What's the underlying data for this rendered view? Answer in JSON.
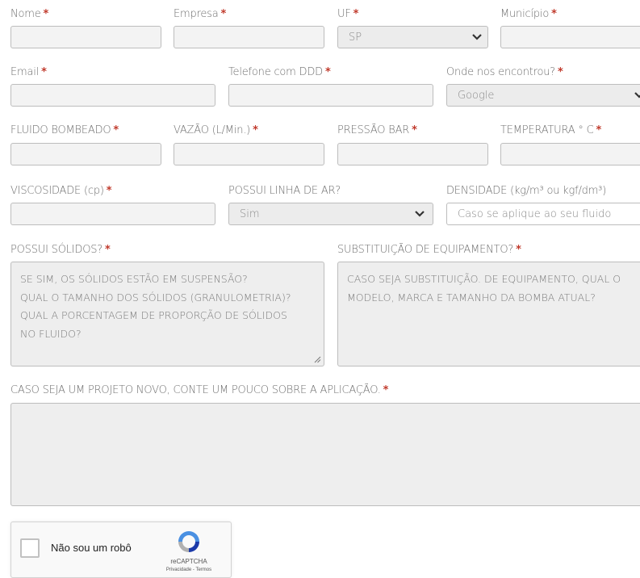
{
  "row1": {
    "nome": "Nome",
    "empresa": "Empresa",
    "uf": "UF",
    "uf_value": "SP",
    "municipio": "Município"
  },
  "row2": {
    "email": "Email",
    "telefone": "Telefone com DDD",
    "onde": "Onde nos encontrou?",
    "onde_value": "Google"
  },
  "row3": {
    "fluido": "FLUIDO BOMBEADO",
    "vazao": "VAZÃO (L/Min.)",
    "pressao": "PRESSÃO BAR",
    "temperatura": "TEMPERATURA ° C"
  },
  "row4": {
    "viscosidade": "VISCOSIDADE (cp)",
    "linha_ar": "POSSUI LINHA DE AR?",
    "linha_ar_value": "Sim",
    "densidade": "DENSIDADE (kg/m³ ou kgf/dm³)",
    "densidade_placeholder": "Caso se aplique ao seu fluido"
  },
  "row5": {
    "solidos": "POSSUI SÓLIDOS?",
    "solidos_placeholder": "SE SIM, OS SÓLIDOS ESTÃO EM SUSPENSÃO?\nQUAL O TAMANHO DOS SÓLIDOS (GRANULOMETRIA)?\nQUAL A PORCENTAGEM DE PROPORÇÃO DE SÓLIDOS\nNO FLUIDO?",
    "substituicao": "SUBSTITUIÇÃO DE EQUIPAMENTO?",
    "substituicao_placeholder": "CASO SEJA SUBSTITUIÇÃO. DE EQUIPAMENTO, QUAL O\nMODELO, MARCA E TAMANHO DA BOMBA ATUAL?"
  },
  "row6": {
    "projeto": "CASO SEJA UM PROJETO NOVO, CONTE UM POUCO SOBRE A APLICAÇÃO."
  },
  "required_marker": "*",
  "recaptcha": {
    "label": "Não sou um robô",
    "brand": "reCAPTCHA",
    "links": "Privacidade - Termos"
  },
  "colors": {
    "required": "#c0392b",
    "field_bg": "#f3f3f3",
    "border": "#bdbdbd"
  },
  "icons": {
    "select_arrow": "chevron-down-icon",
    "recaptcha": "recaptcha-logo-icon"
  }
}
